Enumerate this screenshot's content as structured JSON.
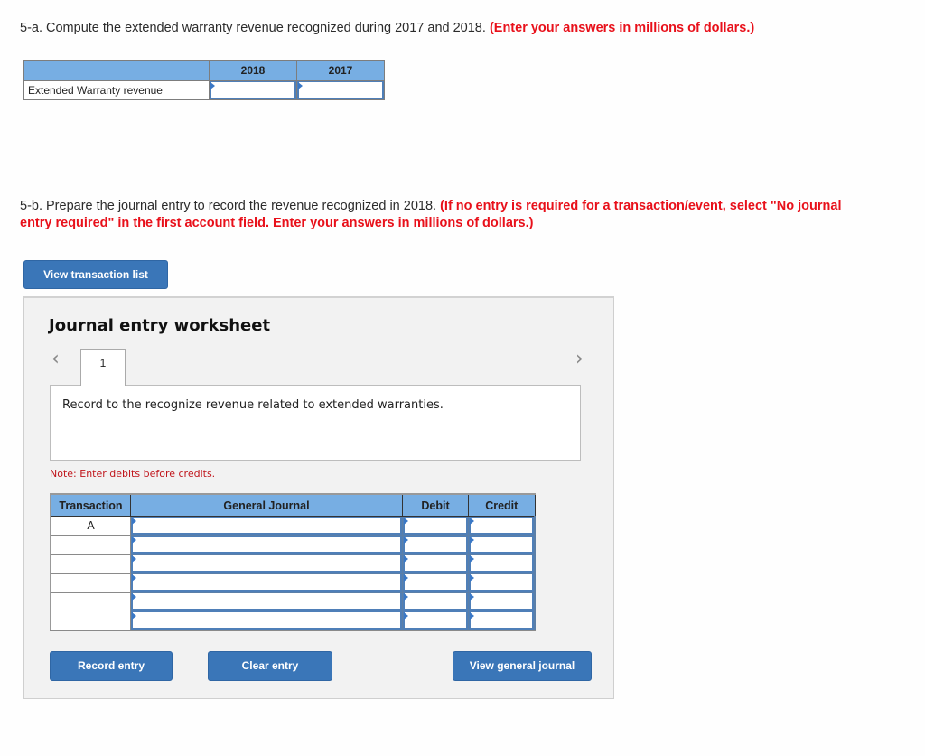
{
  "part_a": {
    "prompt": "5-a. Compute the extended warranty revenue recognized during 2017 and 2018.",
    "instruction": "(Enter your answers in millions of dollars.)",
    "table": {
      "headers": [
        "",
        "2018",
        "2017"
      ],
      "rows": [
        {
          "label": "Extended Warranty revenue",
          "values": [
            "",
            ""
          ]
        }
      ]
    }
  },
  "part_b": {
    "prompt": "5-b. Prepare the journal entry to record the revenue recognized in 2018.",
    "instruction": "(If no entry is required for a transaction/event, select \"No journal entry required\" in the first account field. Enter your answers in millions of dollars.)",
    "view_transaction_list_label": "View transaction list"
  },
  "worksheet": {
    "title": "Journal entry worksheet",
    "nav_prev_icon": "chevron-left",
    "nav_next_icon": "chevron-right",
    "prev_glyph": "‹",
    "next_glyph": "›",
    "tabs": [
      "1"
    ],
    "active_tab": "1",
    "description": "Record to the recognize revenue related to extended warranties.",
    "note": "Note: Enter debits before credits.",
    "table": {
      "headers": [
        "Transaction",
        "General Journal",
        "Debit",
        "Credit"
      ],
      "rows": [
        {
          "transaction": "A",
          "account": "",
          "debit": "",
          "credit": ""
        },
        {
          "transaction": "",
          "account": "",
          "debit": "",
          "credit": ""
        },
        {
          "transaction": "",
          "account": "",
          "debit": "",
          "credit": ""
        },
        {
          "transaction": "",
          "account": "",
          "debit": "",
          "credit": ""
        },
        {
          "transaction": "",
          "account": "",
          "debit": "",
          "credit": ""
        },
        {
          "transaction": "",
          "account": "",
          "debit": "",
          "credit": ""
        }
      ]
    },
    "buttons": {
      "record": "Record entry",
      "clear": "Clear entry",
      "view_general_journal": "View general journal"
    }
  },
  "colors": {
    "accent_button": "#3a76b8",
    "header_fill": "#77aee3",
    "instruction_red": "#e8101a",
    "note_red": "#c0161c",
    "panel_bg": "#f2f2f2"
  }
}
